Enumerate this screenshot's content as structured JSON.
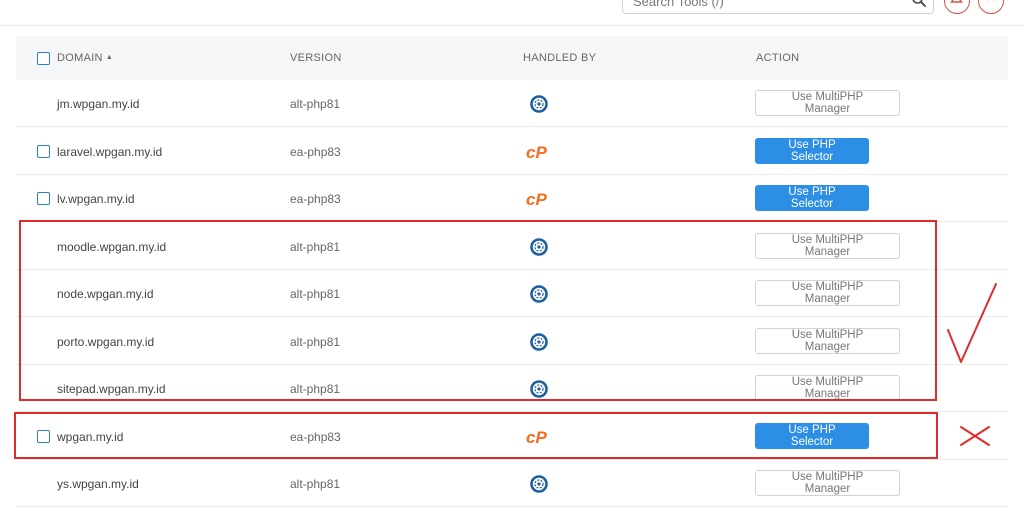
{
  "search": {
    "placeholder": "Search Tools (/)"
  },
  "table": {
    "headers": {
      "domain": "DOMAIN",
      "version": "VERSION",
      "handled_by": "HANDLED BY",
      "action": "ACTION"
    },
    "rows": [
      {
        "domain": "jm.wpgan.my.id",
        "version": "alt-php81",
        "handler": "cloudlinux-icon",
        "action": "Use MultiPHP Manager",
        "checkbox": false
      },
      {
        "domain": "laravel.wpgan.my.id",
        "version": "ea-php83",
        "handler": "cpanel-icon",
        "action": "Use PHP Selector",
        "checkbox": true
      },
      {
        "domain": "lv.wpgan.my.id",
        "version": "ea-php83",
        "handler": "cpanel-icon",
        "action": "Use PHP Selector",
        "checkbox": true
      },
      {
        "domain": "moodle.wpgan.my.id",
        "version": "alt-php81",
        "handler": "cloudlinux-icon",
        "action": "Use MultiPHP Manager",
        "checkbox": false
      },
      {
        "domain": "node.wpgan.my.id",
        "version": "alt-php81",
        "handler": "cloudlinux-icon",
        "action": "Use MultiPHP Manager",
        "checkbox": false
      },
      {
        "domain": "porto.wpgan.my.id",
        "version": "alt-php81",
        "handler": "cloudlinux-icon",
        "action": "Use MultiPHP Manager",
        "checkbox": false
      },
      {
        "domain": "sitepad.wpgan.my.id",
        "version": "alt-php81",
        "handler": "cloudlinux-icon",
        "action": "Use MultiPHP Manager",
        "checkbox": false
      },
      {
        "domain": "wpgan.my.id",
        "version": "ea-php83",
        "handler": "cpanel-icon",
        "action": "Use PHP Selector",
        "checkbox": true
      },
      {
        "domain": "ys.wpgan.my.id",
        "version": "alt-php81",
        "handler": "cloudlinux-icon",
        "action": "Use MultiPHP Manager",
        "checkbox": false
      }
    ]
  },
  "colors": {
    "accent_blue": "#2d8ee6",
    "checkbox_blue": "#2f7fd1",
    "cpanel_orange": "#f36d21",
    "cloudlinux_blue": "#1f5f9e",
    "annotation_red": "#e02b2b"
  }
}
